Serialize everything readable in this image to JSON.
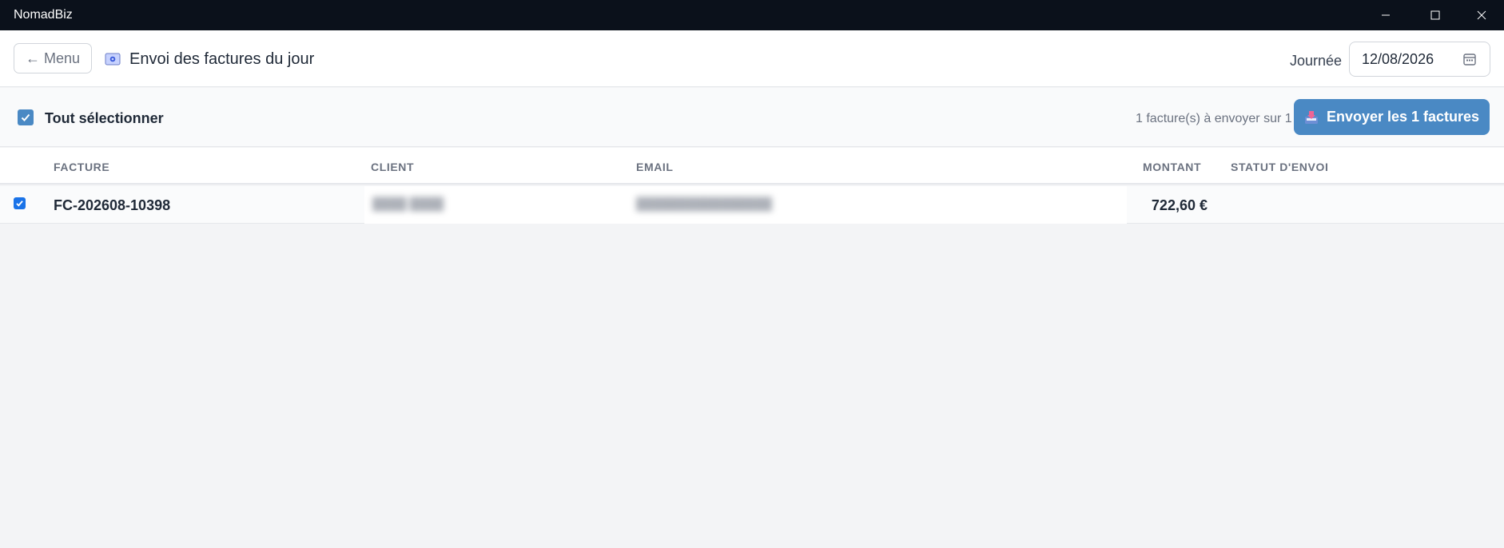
{
  "window": {
    "title": "NomadBiz"
  },
  "header": {
    "back_label": "← Menu",
    "title": "Envoi des factures du jour",
    "day_label": "Journée",
    "date_value": "12/08/2026"
  },
  "toolbar": {
    "select_all_label": "Tout sélectionner",
    "select_all_checked": true,
    "count_text": "1 facture(s) à envoyer sur 1",
    "send_label": "Envoyer les 1 factures"
  },
  "table": {
    "columns": [
      "FACTURE",
      "CLIENT",
      "EMAIL",
      "MONTANT",
      "STATUT D'ENVOI"
    ],
    "rows": [
      {
        "checked": true,
        "facture": "FC-202608-10398",
        "client": "████ ████",
        "email": "████████████████",
        "montant": "722,60 €",
        "statut": ""
      }
    ]
  },
  "colors": {
    "titlebar": "#0b111b",
    "accent": "#4a89c4",
    "checkbox": "#1a73e8",
    "background": "#f3f4f6"
  },
  "icons": {
    "page": "envelope-icon",
    "date": "calendar-icon",
    "send": "inbox-tray-icon",
    "check": "checkmark-icon"
  }
}
